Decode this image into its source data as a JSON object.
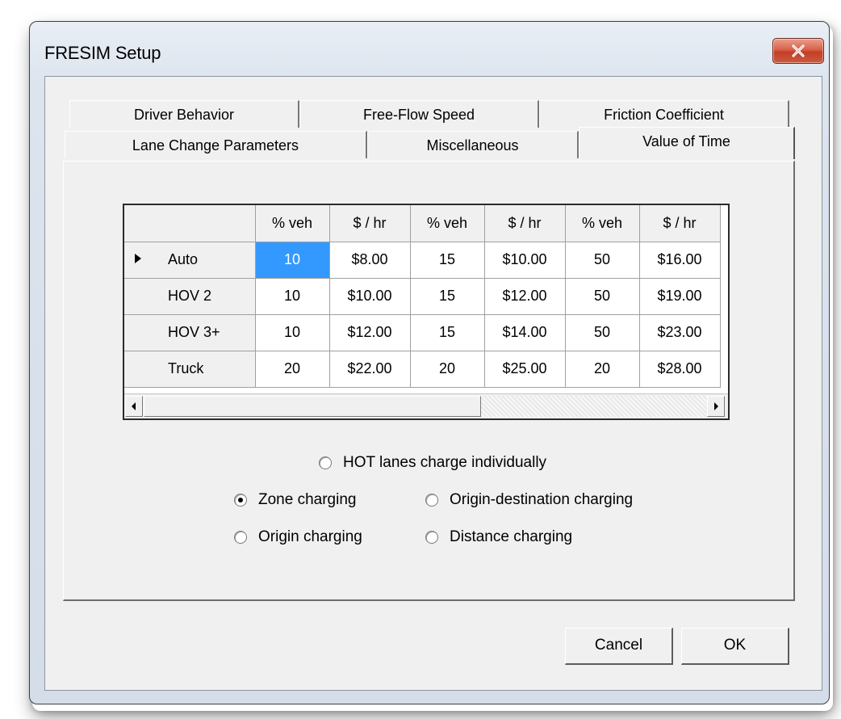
{
  "window": {
    "title": "FRESIM Setup"
  },
  "tabs": {
    "row1": [
      {
        "label": "Driver Behavior"
      },
      {
        "label": "Free-Flow Speed"
      },
      {
        "label": "Friction Coefficient"
      }
    ],
    "row2": [
      {
        "label": "Lane Change Parameters"
      },
      {
        "label": "Miscellaneous"
      },
      {
        "label": "Value of Time",
        "selected": true
      }
    ]
  },
  "grid": {
    "columns": [
      "% veh",
      "$ / hr",
      "% veh",
      "$ / hr",
      "% veh",
      "$ / hr"
    ],
    "rows": [
      {
        "label": "Auto",
        "current": true,
        "values": [
          "10",
          "$8.00",
          "15",
          "$10.00",
          "50",
          "$16.00"
        ]
      },
      {
        "label": "HOV 2",
        "values": [
          "10",
          "$10.00",
          "15",
          "$12.00",
          "50",
          "$19.00"
        ]
      },
      {
        "label": "HOV 3+",
        "values": [
          "10",
          "$12.00",
          "15",
          "$14.00",
          "50",
          "$23.00"
        ]
      },
      {
        "label": "Truck",
        "values": [
          "20",
          "$22.00",
          "20",
          "$25.00",
          "20",
          "$28.00"
        ]
      }
    ]
  },
  "options": {
    "hot_lanes": {
      "label": "HOT lanes charge individually",
      "checked": false
    },
    "zone": {
      "label": "Zone charging",
      "checked": true
    },
    "od": {
      "label": "Origin-destination charging",
      "checked": false
    },
    "origin": {
      "label": "Origin charging",
      "checked": false
    },
    "distance": {
      "label": "Distance charging",
      "checked": false
    }
  },
  "buttons": {
    "cancel": "Cancel",
    "ok": "OK"
  },
  "colors": {
    "selection": "#3399ff",
    "close_button": "#c23f26"
  }
}
